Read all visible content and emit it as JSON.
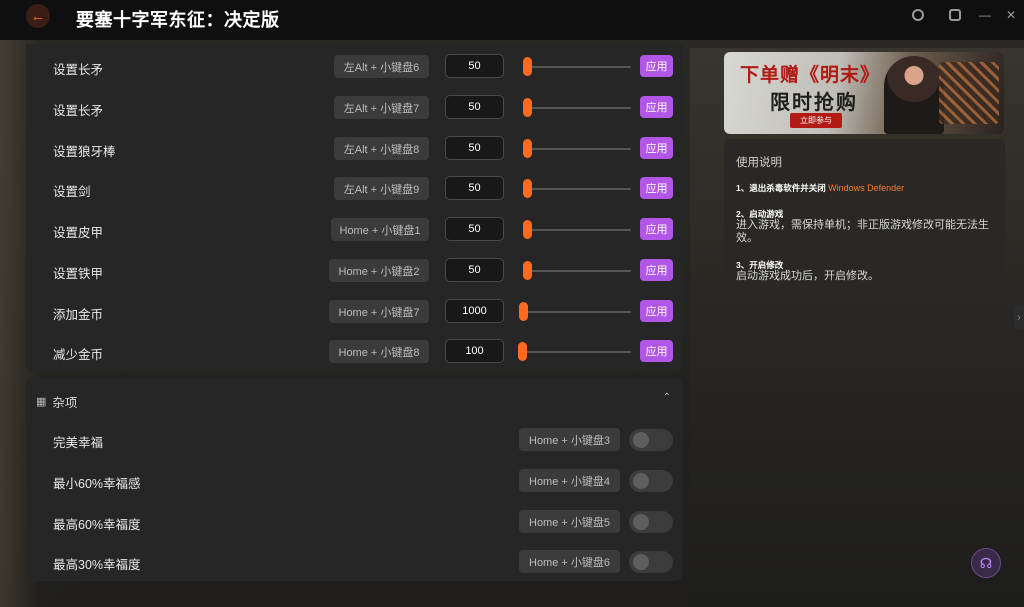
{
  "app": {
    "title": "要塞十字军东征：决定版"
  },
  "window_controls": [
    "user-icon",
    "settings-icon",
    "minimize-icon",
    "close-icon"
  ],
  "colors": {
    "accent_orange": "#ff6a1e",
    "apply_purple": "#b256e8"
  },
  "items": [
    {
      "label": "设置长矛",
      "hotkey": "左Alt + 小键盘6",
      "value": "50",
      "apply_label": "应用"
    },
    {
      "label": "设置长矛",
      "hotkey": "左Alt + 小键盘7",
      "value": "50",
      "apply_label": "应用"
    },
    {
      "label": "设置狼牙棒",
      "hotkey": "左Alt + 小键盘8",
      "value": "50",
      "apply_label": "应用"
    },
    {
      "label": "设置剑",
      "hotkey": "左Alt + 小键盘9",
      "value": "50",
      "apply_label": "应用"
    },
    {
      "label": "设置皮甲",
      "hotkey": "Home + 小键盘1",
      "value": "50",
      "apply_label": "应用"
    },
    {
      "label": "设置铁甲",
      "hotkey": "Home + 小键盘2",
      "value": "50",
      "apply_label": "应用"
    },
    {
      "label": "添加金币",
      "hotkey": "Home + 小键盘7",
      "value": "1000",
      "apply_label": "应用"
    },
    {
      "label": "减少金币",
      "hotkey": "Home + 小键盘8",
      "value": "100",
      "apply_label": "应用"
    }
  ],
  "misc": {
    "header": "杂项",
    "toggles": [
      {
        "label": "完美幸福",
        "hotkey": "Home + 小键盘3",
        "on": false
      },
      {
        "label": "最小60%幸福感",
        "hotkey": "Home + 小键盘4",
        "on": false
      },
      {
        "label": "最高60%幸福度",
        "hotkey": "Home + 小键盘5",
        "on": false
      },
      {
        "label": "最高30%幸福度",
        "hotkey": "Home + 小键盘6",
        "on": false
      }
    ]
  },
  "banner": {
    "line1": "下单赠《明末》",
    "line2": "限时抢购",
    "cta": "立即参与"
  },
  "instructions": {
    "title": "使用说明",
    "step1_title": "1、退出杀毒软件并关闭",
    "step1_highlight": "Windows Defender",
    "step2_title": "2、启动游戏",
    "step2_text": "进入游戏，需保持单机；非正版游戏修改可能无法生效。",
    "step3_title": "3、开启修改",
    "step3_text": "启动游戏成功后，开启修改。"
  }
}
